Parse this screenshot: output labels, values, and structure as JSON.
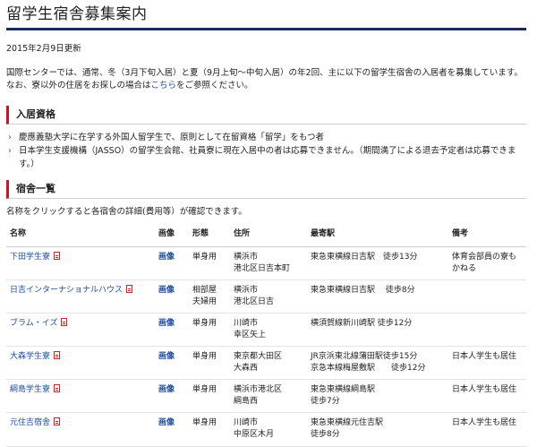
{
  "title": "留学生宿舎募集案内",
  "updated": "2015年2月9日更新",
  "intro": {
    "line1": "国際センターでは、通常、冬（3月下旬入居）と夏（9月上旬〜中旬入居）の年2回、主に以下の留学生宿舎の入居者を募集しています。",
    "line2_before": "なお、寮以外の住居をお探しの場合は",
    "line2_link": "こちら",
    "line2_after": "をご参照ください。"
  },
  "qualification": {
    "heading": "入居資格",
    "items": [
      "慶應義塾大学に在学する外国人留学生で、原則として在留資格「留学」をもつ者",
      "日本学生支援機構（JASSO）の留学生会館、社員寮に現在入居中の者は応募できません。（期間満了による退去予定者は応募できます。）"
    ]
  },
  "dorm_list": {
    "heading": "宿舎一覧",
    "note": "名称をクリックすると各宿舎の詳細(費用等）が確認できます。",
    "columns": [
      "名称",
      "画像",
      "形態",
      "住所",
      "最寄駅",
      "備考"
    ],
    "rows": [
      {
        "name": "下田学生寮",
        "image": "画像",
        "type": "単身用",
        "address": [
          "横浜市",
          "港北区日吉本町"
        ],
        "station": [
          "東急東横線日吉駅　徒歩13分"
        ],
        "note": "体育会部員の寮もかねる"
      },
      {
        "name": "日吉インターナショナルハウス",
        "image": "画像",
        "type": "相部屋\n夫婦用",
        "address": [
          "横浜市",
          "港北区日吉"
        ],
        "station": [
          "東急東横線日吉駅　 徒歩8分"
        ],
        "note": ""
      },
      {
        "name": "ブラム・イズ",
        "image": "画像",
        "type": "単身用",
        "address": [
          "川崎市",
          "幸区矢上"
        ],
        "station": [
          "横須賀線新川崎駅 徒歩12分"
        ],
        "note": ""
      },
      {
        "name": "大森学生寮",
        "image": "画像",
        "type": "単身用",
        "address": [
          "東京都大田区",
          "大森西"
        ],
        "station": [
          "JR京浜東北線蒲田駅徒歩15分",
          "京急本線梅屋敷駅　　徒歩12分"
        ],
        "note": "日本人学生も居住"
      },
      {
        "name": "綱島学生寮",
        "image": "画像",
        "type": "単身用",
        "address": [
          "横浜市港北区",
          "綱島西"
        ],
        "station": [
          "東急東横線綱島駅",
          "徒歩7分"
        ],
        "note": "日本人学生も居住"
      },
      {
        "name": "元住吉宿舎",
        "image": "画像",
        "type": "単身用",
        "address": [
          "川崎市",
          "中原区木月"
        ],
        "station": [
          "東急東横線元住吉駅",
          "徒歩8分"
        ],
        "note": "日本人学生も居住"
      }
    ]
  },
  "colors": {
    "title_rule": "#1a2a5e",
    "section_accent": "#c0182b",
    "link": "#1f4da0"
  },
  "icons": {
    "list_marker": "chevron-right-icon",
    "pdf": "pdf-icon"
  }
}
